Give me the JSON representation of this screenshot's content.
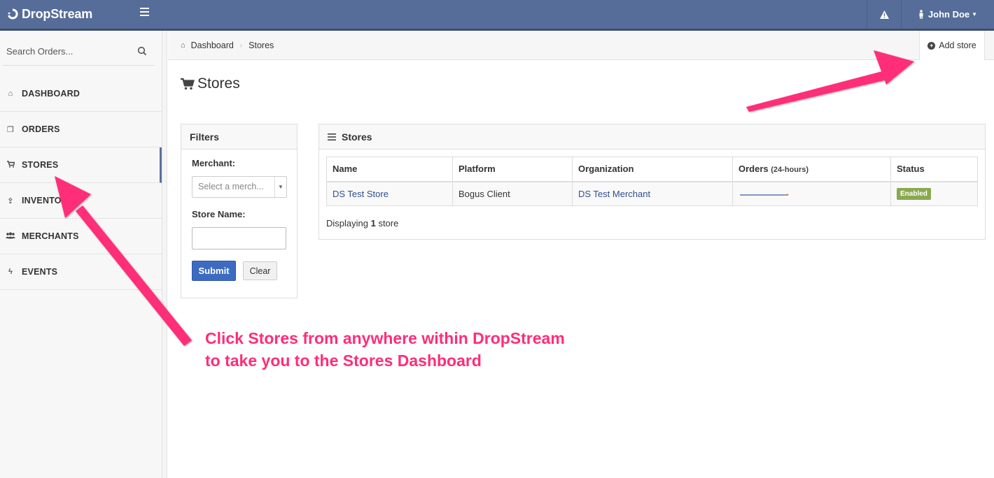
{
  "app": {
    "brand": "DropStream"
  },
  "topbar": {
    "user_name": "John Doe"
  },
  "sidebar": {
    "search_placeholder": "Search Orders...",
    "items": [
      {
        "label": "DASHBOARD",
        "icon": "home-icon"
      },
      {
        "label": "ORDERS",
        "icon": "copy-icon"
      },
      {
        "label": "STORES",
        "icon": "cart-icon",
        "active": true
      },
      {
        "label": "INVENTO",
        "icon": "upload-icon"
      },
      {
        "label": "MERCHANTS",
        "icon": "users-icon"
      },
      {
        "label": "EVENTS",
        "icon": "bolt-icon"
      }
    ]
  },
  "breadcrumb": {
    "home": "Dashboard",
    "current": "Stores"
  },
  "actions": {
    "add_store": "Add store"
  },
  "page": {
    "title": "Stores"
  },
  "filters": {
    "title": "Filters",
    "merchant_label": "Merchant:",
    "merchant_placeholder": "Select a merch...",
    "store_name_label": "Store Name:",
    "store_name_value": "",
    "submit": "Submit",
    "clear": "Clear"
  },
  "stores_panel": {
    "title": "Stores",
    "columns": {
      "name": "Name",
      "platform": "Platform",
      "organization": "Organization",
      "orders": "Orders",
      "orders_sub": "(24-hours)",
      "status": "Status"
    },
    "rows": [
      {
        "name": "DS Test Store",
        "platform": "Bogus Client",
        "organization": "DS Test Merchant",
        "status": "Enabled"
      }
    ],
    "footer_prefix": "Displaying ",
    "footer_count": "1",
    "footer_suffix": " store"
  },
  "annotation": {
    "line1": "Click Stores from anywhere within DropStream",
    "line2": "to take you to the Stores Dashboard",
    "color": "#ff2d78"
  },
  "colors": {
    "navbar": "#566d9a",
    "primary_button": "#3d6bc2",
    "enabled_badge": "#8aa94f",
    "link": "#2f4f8f"
  }
}
